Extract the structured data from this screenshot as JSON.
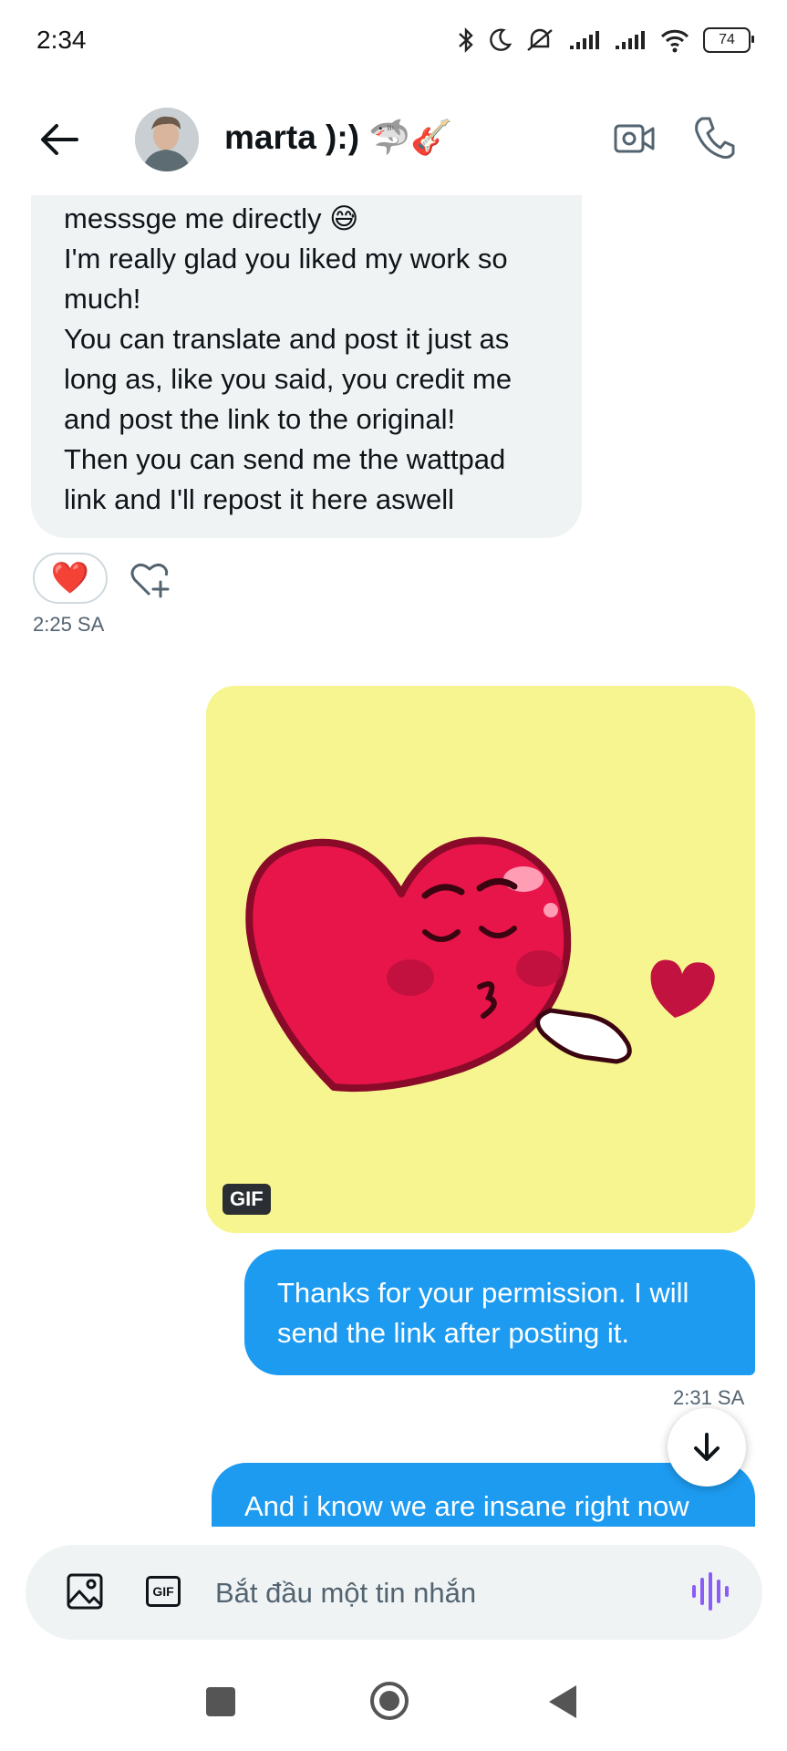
{
  "status_bar": {
    "time": "2:34",
    "battery": "74"
  },
  "header": {
    "contact_name": "marta ):) 🦈🎸"
  },
  "incoming_message": {
    "text": "messsge me directly 😅\nI'm really glad you liked my work so much!\nYou can translate and post it just as long as, like you said, you credit me and post the link to the original!\nThen you can send me the wattpad link and I'll repost it here aswell",
    "reaction": "❤️",
    "time": "2:25 SA"
  },
  "gif_message": {
    "badge": "GIF"
  },
  "outgoing_messages": [
    {
      "text": "Thanks for your permission. I will send the link after posting it.",
      "time": "2:31 SA"
    },
    {
      "text": "And i know we are insane right now"
    }
  ],
  "composer": {
    "placeholder": "Bắt đầu một tin nhắn",
    "gif_label": "GIF"
  },
  "colors": {
    "accent": "#1d9bf0",
    "incoming_bg": "#eff3f4",
    "voice_icon": "#8b5cf6"
  },
  "icons": [
    "back-arrow-icon",
    "video-call-icon",
    "phone-icon",
    "add-reaction-icon",
    "image-icon",
    "gif-icon",
    "voice-icon",
    "arrow-down-icon"
  ]
}
